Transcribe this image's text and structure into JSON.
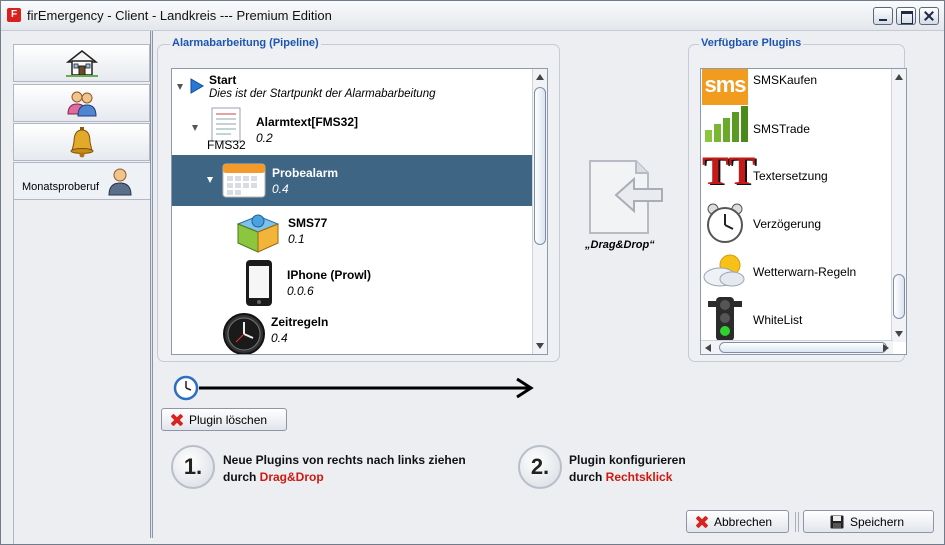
{
  "window": {
    "title": "firEmergency - Client - Landkreis --- Premium Edition",
    "app_icon": "F"
  },
  "nav": {
    "tabs": [
      {
        "icon": "house-icon"
      },
      {
        "icon": "users-icon"
      },
      {
        "icon": "bell-icon"
      },
      {
        "icon": "user-icon",
        "label": "Monatsproberuf",
        "active": true
      }
    ]
  },
  "pipeline": {
    "title": "Alarmabarbeitung (Pipeline)",
    "nodes": [
      {
        "name": "Start",
        "sub": "Dies ist der Startpunkt der Alarmabarbeitung",
        "icon": "play-icon"
      },
      {
        "name": "Alarmtext[FMS32]",
        "sub": "0.2",
        "icon": "document-icon",
        "icon_caption": "FMS32"
      },
      {
        "name": "Probealarm",
        "sub": "0.4",
        "icon": "calendar-icon",
        "selected": true
      },
      {
        "name": "SMS77",
        "sub": "0.1",
        "icon": "sms-box-icon"
      },
      {
        "name": "IPhone (Prowl)",
        "sub": "0.0.6",
        "icon": "phone-icon"
      },
      {
        "name": "Zeitregeln",
        "sub": "0.4",
        "icon": "clock-icon"
      }
    ]
  },
  "plugins": {
    "title": "Verfügbare Plugins",
    "items": [
      {
        "label": "SMSKaufen",
        "icon": "sms-logo-icon",
        "icon_text": "sms"
      },
      {
        "label": "SMSTrade",
        "icon": "bar-chart-icon"
      },
      {
        "label": "Textersetzung",
        "icon": "text-replace-icon",
        "icon_text": "TT"
      },
      {
        "label": "Verzögerung",
        "icon": "alarm-clock-icon"
      },
      {
        "label": "Wetterwarn-Regeln",
        "icon": "weather-icon"
      },
      {
        "label": "WhiteList",
        "icon": "traffic-light-icon"
      }
    ]
  },
  "dragdrop": {
    "label": "„Drag&Drop“"
  },
  "buttons": {
    "delete": "Plugin löschen",
    "cancel": "Abbrechen",
    "save": "Speichern"
  },
  "steps": [
    {
      "number": "1.",
      "line1": "Neue Plugins von rechts nach links ziehen",
      "line2_prefix": "durch ",
      "line2_highlight": "Drag&Drop"
    },
    {
      "number": "2.",
      "line1": "Plugin konfigurieren",
      "line2_prefix": "durch ",
      "line2_highlight": "Rechtsklick"
    }
  ],
  "colors": {
    "accent": "#1c55b0",
    "selection": "#3e6684",
    "highlight": "#cc1a10"
  }
}
